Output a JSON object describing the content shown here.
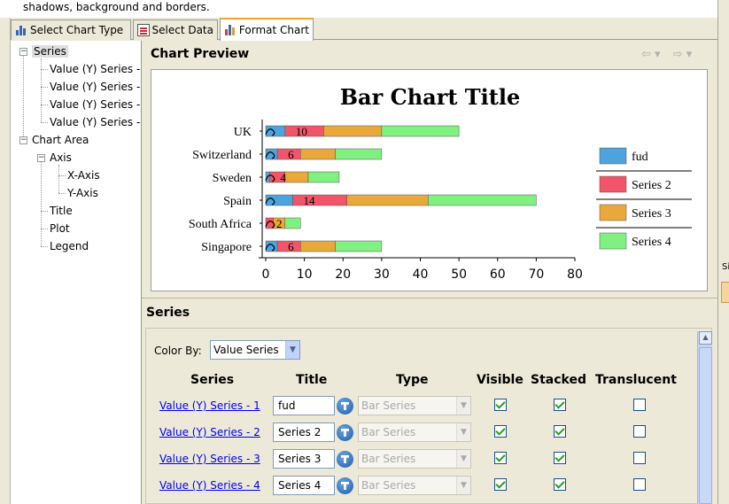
{
  "top_text": "shadows, background and borders.",
  "tabs": [
    {
      "label": "Select Chart Type",
      "icon": "chart-type-icon"
    },
    {
      "label": "Select Data",
      "icon": "select-data-icon"
    },
    {
      "label": "Format Chart",
      "icon": "format-chart-icon"
    }
  ],
  "tree": {
    "series": "Series",
    "series_items": [
      "Value (Y) Series -",
      "Value (Y) Series -",
      "Value (Y) Series -",
      "Value (Y) Series -"
    ],
    "chart_area": "Chart Area",
    "axis": "Axis",
    "x_axis": "X-Axis",
    "y_axis": "Y-Axis",
    "title": "Title",
    "plot": "Plot",
    "legend": "Legend"
  },
  "preview": {
    "heading": "Chart Preview",
    "back_icon": "back-arrow-icon",
    "forward_icon": "forward-arrow-icon"
  },
  "chart_data": {
    "type": "bar",
    "orientation": "horizontal",
    "stacked": true,
    "title": "Bar Chart Title",
    "categories": [
      "UK",
      "Switzerland",
      "Sweden",
      "Spain",
      "South Africa",
      "Singapore"
    ],
    "series": [
      {
        "name": "fud",
        "values": [
          5,
          3,
          1,
          7,
          0,
          3
        ],
        "color": "#4ea3dd"
      },
      {
        "name": "Series 2",
        "values": [
          10,
          6,
          4,
          14,
          2,
          6
        ],
        "color": "#f25569"
      },
      {
        "name": "Series 3",
        "values": [
          15,
          9,
          6,
          21,
          3,
          9
        ],
        "color": "#e9a83a"
      },
      {
        "name": "Series 4",
        "values": [
          20,
          12,
          8,
          28,
          4,
          12
        ],
        "color": "#80f080"
      }
    ],
    "data_labels": [
      "10",
      "6",
      "4",
      "14",
      "2",
      "6"
    ],
    "x_ticks": [
      "0",
      "10",
      "20",
      "30",
      "40",
      "50",
      "60",
      "70",
      "80"
    ],
    "xlim": [
      0,
      80
    ],
    "grid": false,
    "legend_position": "right"
  },
  "series_section": {
    "heading": "Series",
    "color_by_label": "Color By:",
    "color_by_value": "Value Series",
    "columns": [
      "Series",
      "Title",
      "Type",
      "Visible",
      "Stacked",
      "Translucent"
    ],
    "rows": [
      {
        "series": "Value (Y) Series - 1",
        "title": "fud",
        "type": "Bar Series",
        "visible": true,
        "stacked": true,
        "translucent": false
      },
      {
        "series": "Value (Y) Series - 2",
        "title": "Series 2",
        "type": "Bar Series",
        "visible": true,
        "stacked": true,
        "translucent": false
      },
      {
        "series": "Value (Y) Series - 3",
        "title": "Series 3",
        "type": "Bar Series",
        "visible": true,
        "stacked": true,
        "translucent": false
      },
      {
        "series": "Value (Y) Series - 4",
        "title": "Series 4",
        "type": "Bar Series",
        "visible": true,
        "stacked": true,
        "translucent": false
      }
    ]
  }
}
